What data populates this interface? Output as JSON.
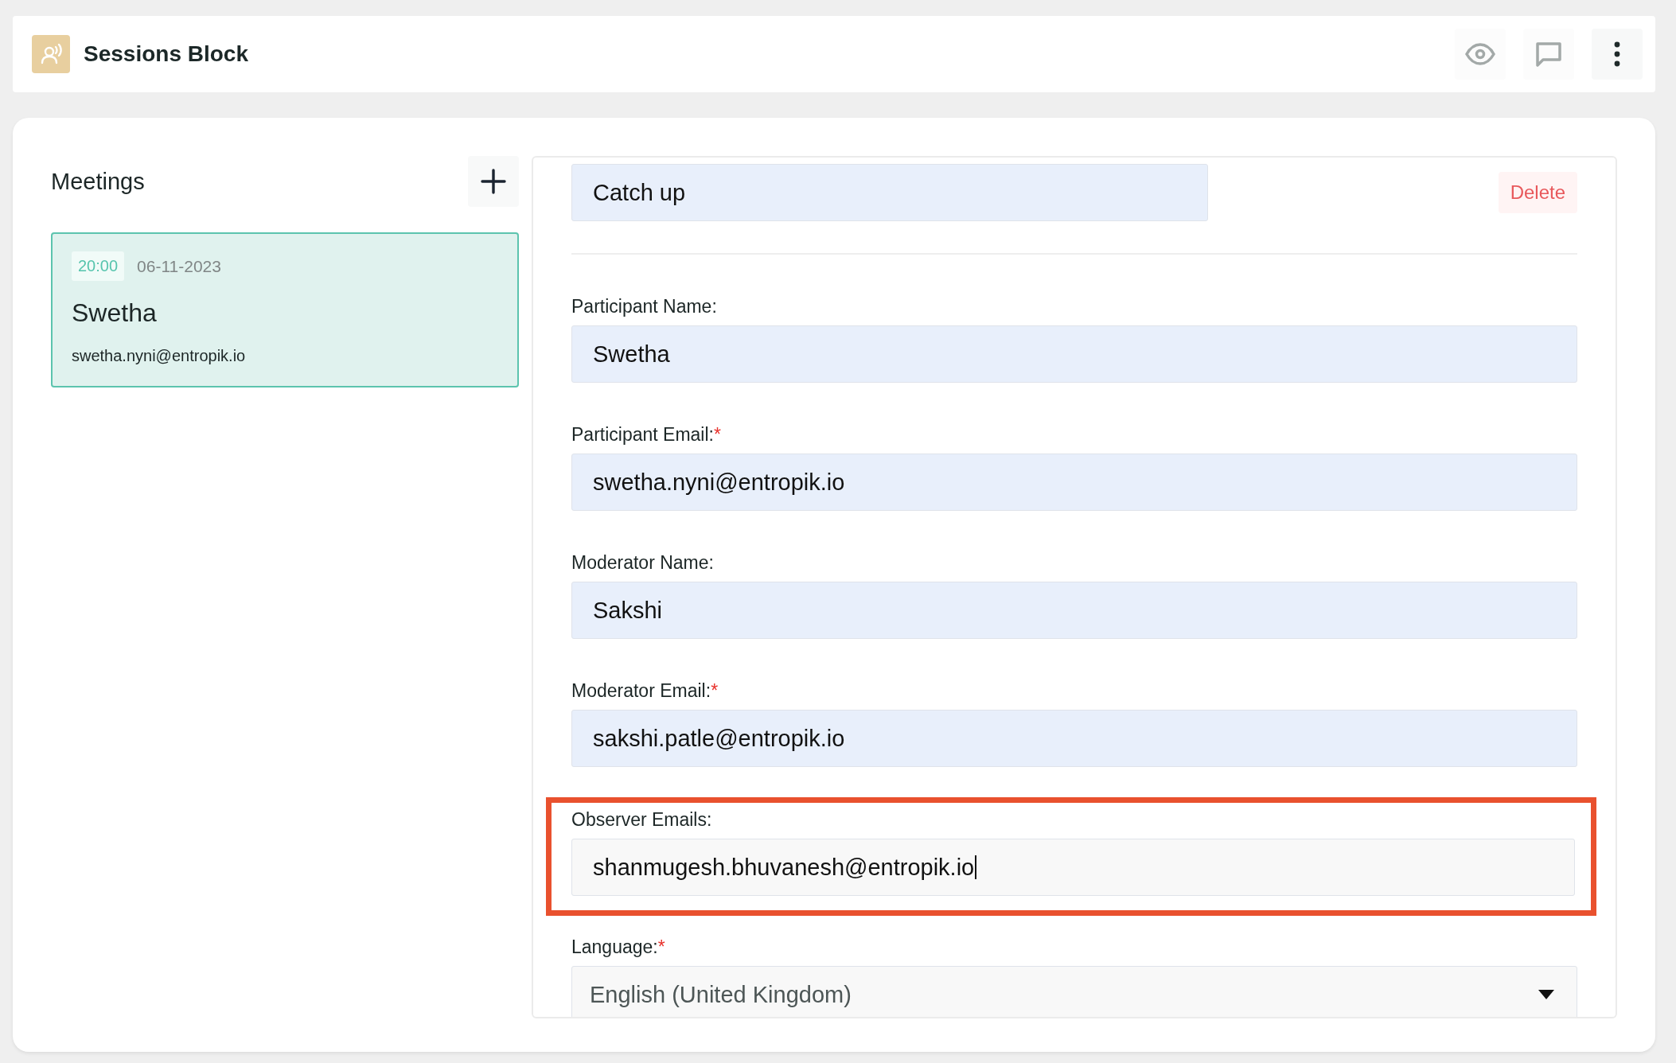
{
  "header": {
    "title": "Sessions Block"
  },
  "meetings": {
    "title": "Meetings",
    "items": [
      {
        "time": "20:00",
        "date": "06-11-2023",
        "name": "Swetha",
        "email": "swetha.nyni@entropik.io",
        "selected": true
      }
    ]
  },
  "form": {
    "session_name": "Catch up",
    "delete_label": "Delete",
    "fields": [
      {
        "kind": "text",
        "label": "Participant Name:",
        "value": "Swetha",
        "focused": false,
        "highlighted": false
      },
      {
        "kind": "text",
        "label": "Participant Email:",
        "required_mark": "*",
        "value": "swetha.nyni@entropik.io",
        "focused": false,
        "highlighted": false
      },
      {
        "kind": "text",
        "label": "Moderator Name:",
        "value": "Sakshi",
        "focused": false,
        "highlighted": false
      },
      {
        "kind": "text",
        "label": "Moderator Email:",
        "required_mark": "*",
        "value": "sakshi.patle@entropik.io",
        "focused": false,
        "highlighted": false
      },
      {
        "kind": "text",
        "label": "Observer Emails:",
        "value": "shanmugesh.bhuvanesh@entropik.io",
        "focused": true,
        "highlighted": true
      },
      {
        "kind": "select",
        "label": "Language:",
        "required_mark": "*",
        "value": "English (United Kingdom)",
        "focused": false,
        "highlighted": false
      }
    ]
  }
}
